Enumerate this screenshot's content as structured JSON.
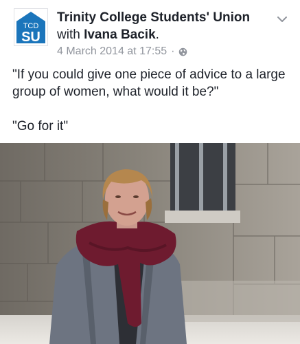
{
  "post": {
    "page_name": "Trinity College Students' Union",
    "with_prefix": "with ",
    "tagged_person": "Ivana Bacik",
    "tagged_suffix": ".",
    "timestamp": "4 March 2014 at 17:55",
    "separator": "·",
    "privacy_icon": "globe-icon",
    "menu_icon": "chevron-down-icon",
    "question": "\"If you could give one piece of advice to a large group of women, what would it be?\"",
    "answer": "\"Go for it\""
  },
  "avatar": {
    "line1": "TCD",
    "line2": "SU",
    "color": "#1b75bb"
  },
  "colors": {
    "text": "#1d2129",
    "meta": "#90949c",
    "scarf": "#6e1b2f",
    "coat": "#6d7481",
    "hair": "#b5874e"
  }
}
